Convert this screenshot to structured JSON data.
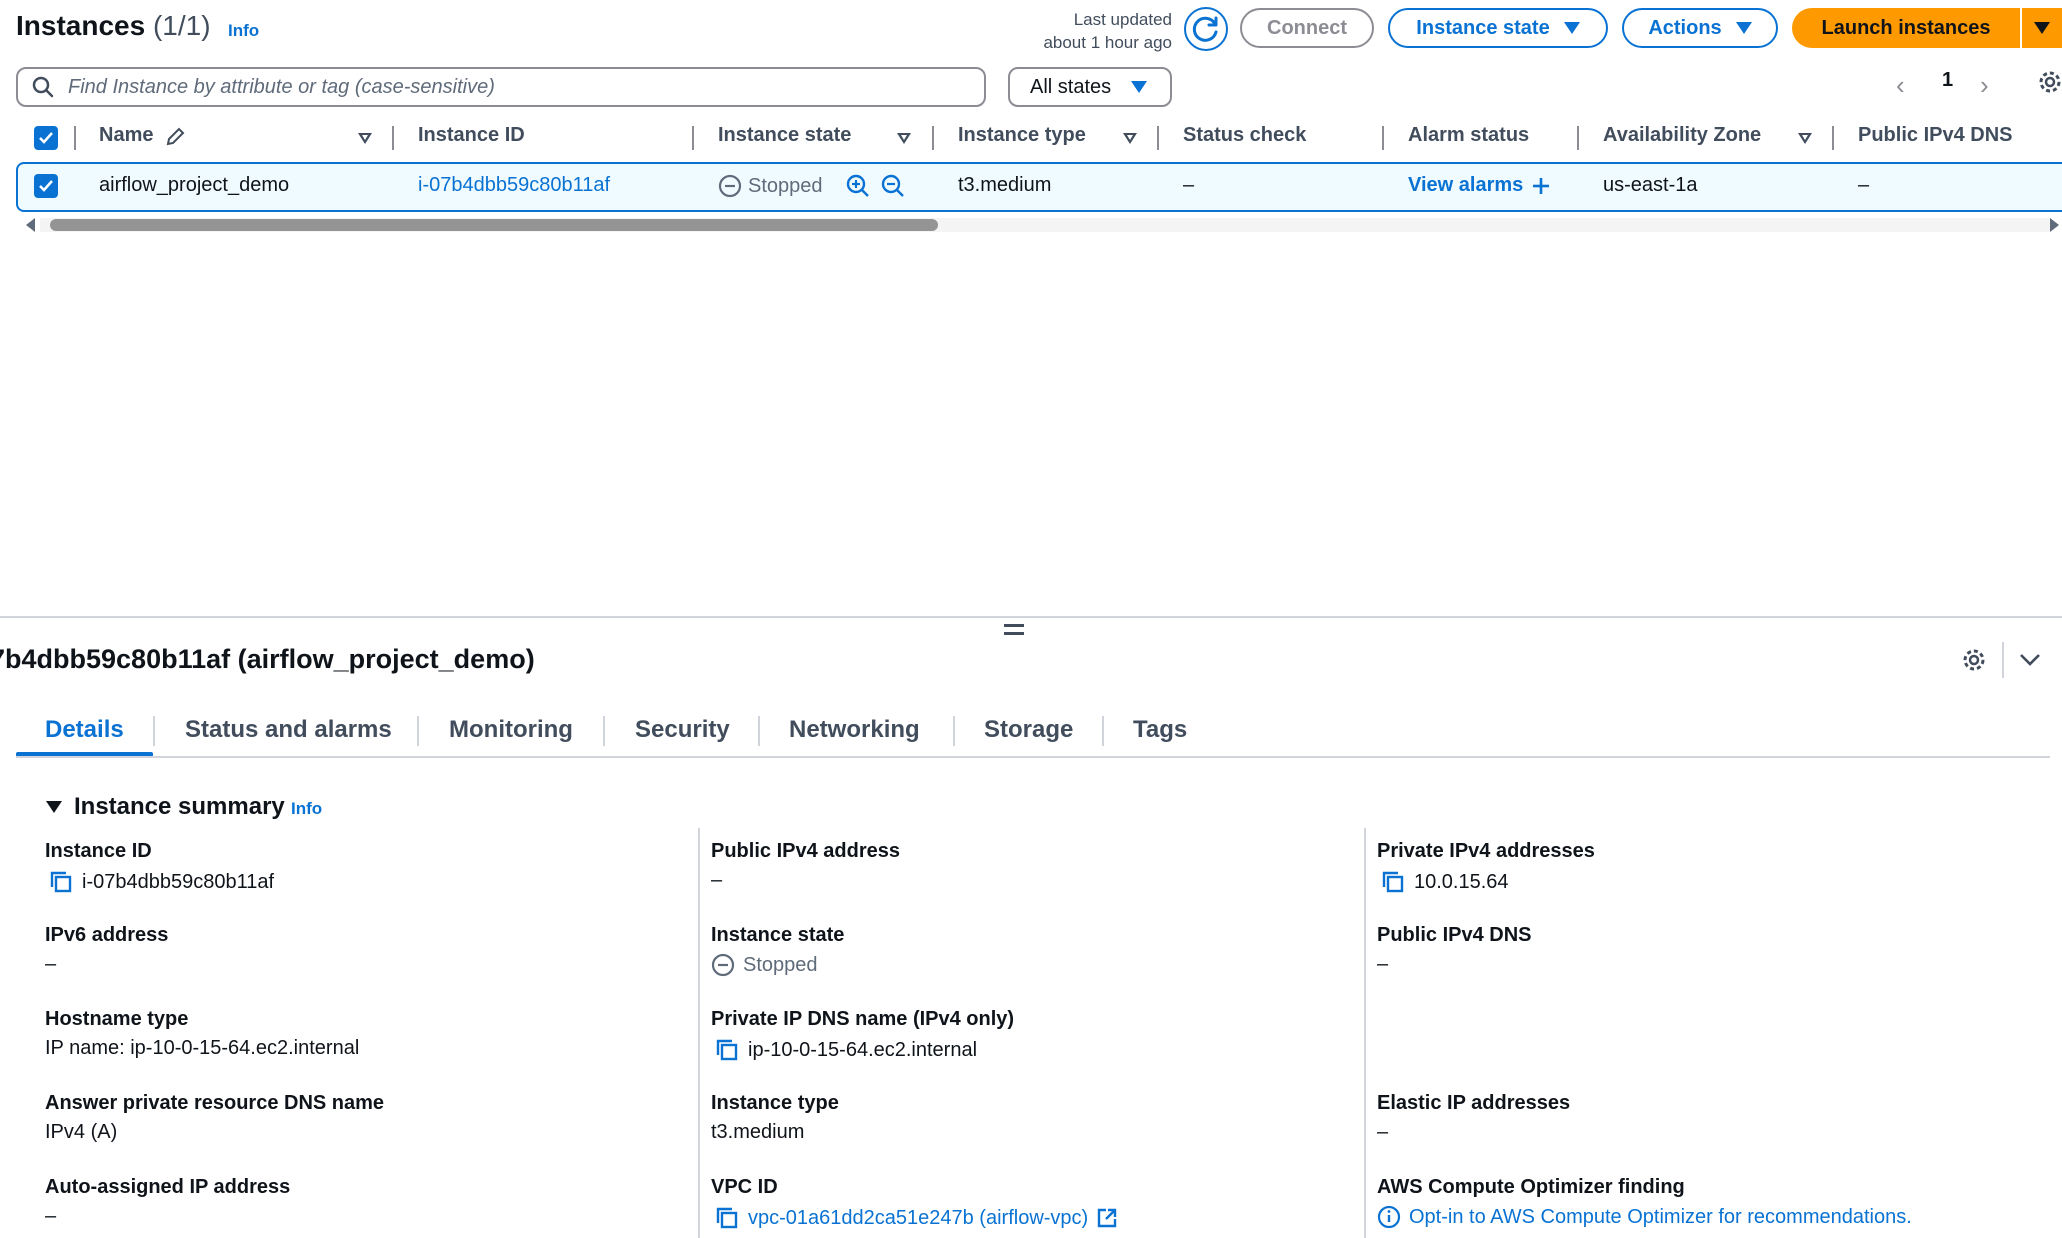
{
  "header": {
    "title": "Instances",
    "count": "(1/1)",
    "info": "Info",
    "last_updated_line1": "Last updated",
    "last_updated_line2": "about 1 hour ago",
    "connect": "Connect",
    "instance_state": "Instance state",
    "actions": "Actions",
    "launch": "Launch instances"
  },
  "search": {
    "placeholder": "Find Instance by attribute or tag (case-sensitive)",
    "filter_value": "All states"
  },
  "pager": {
    "page": "1"
  },
  "table": {
    "columns": [
      "Name",
      "Instance ID",
      "Instance state",
      "Instance type",
      "Status check",
      "Alarm status",
      "Availability Zone",
      "Public IPv4 DNS"
    ],
    "row": {
      "name": "airflow_project_demo",
      "instance_id": "i-07b4dbb59c80b11af",
      "state": "Stopped",
      "type": "t3.medium",
      "status_check": "–",
      "alarm": "View alarms",
      "az": "us-east-1a",
      "dns": "–"
    }
  },
  "panel": {
    "title": "7b4dbb59c80b11af (airflow_project_demo)",
    "tabs": [
      "Details",
      "Status and alarms",
      "Monitoring",
      "Security",
      "Networking",
      "Storage",
      "Tags"
    ],
    "summary_title": "Instance summary",
    "summary_info": "Info",
    "fields": {
      "instance_id": {
        "label": "Instance ID",
        "value": "i-07b4dbb59c80b11af"
      },
      "public_ipv4": {
        "label": "Public IPv4 address",
        "value": "–"
      },
      "private_ipv4": {
        "label": "Private IPv4 addresses",
        "value": "10.0.15.64"
      },
      "ipv6": {
        "label": "IPv6 address",
        "value": "–"
      },
      "instance_state": {
        "label": "Instance state",
        "value": "Stopped"
      },
      "public_dns": {
        "label": "Public IPv4 DNS",
        "value": "–"
      },
      "hostname_type": {
        "label": "Hostname type",
        "value": "IP name: ip-10-0-15-64.ec2.internal"
      },
      "private_dns": {
        "label": "Private IP DNS name (IPv4 only)",
        "value": "ip-10-0-15-64.ec2.internal"
      },
      "answer_dns": {
        "label": "Answer private resource DNS name",
        "value": "IPv4 (A)"
      },
      "instance_type": {
        "label": "Instance type",
        "value": "t3.medium"
      },
      "elastic_ip": {
        "label": "Elastic IP addresses",
        "value": "–"
      },
      "auto_ip": {
        "label": "Auto-assigned IP address",
        "value": "–"
      },
      "vpc_id": {
        "label": "VPC ID",
        "value": "vpc-01a61dd2ca51e247b (airflow-vpc)"
      },
      "optimizer": {
        "label": "AWS Compute Optimizer finding",
        "value": "Opt-in to AWS Compute Optimizer for recommendations."
      }
    }
  },
  "colors": {
    "accent": "#0972d3",
    "primary_button": "#ff9900",
    "text": "#0f141a",
    "muted": "#5f6b7a"
  }
}
